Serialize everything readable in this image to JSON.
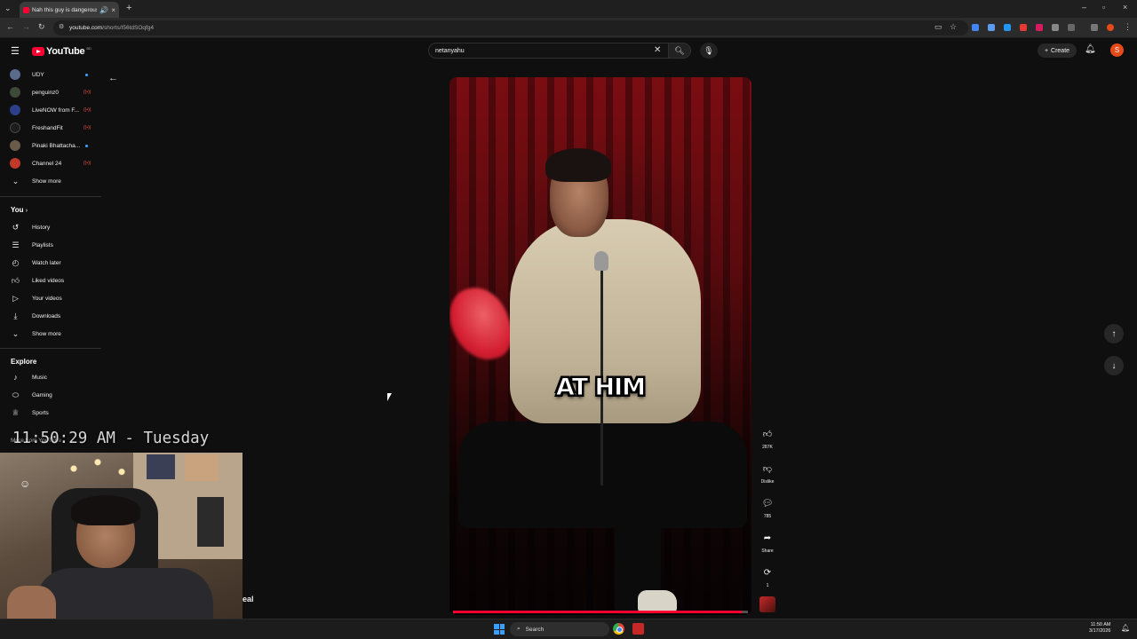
{
  "browser": {
    "tab_title": "Nah this guy is dangerous",
    "url_host": "youtube.com",
    "url_path": "/shorts/I56tdSOqfg4"
  },
  "header": {
    "logo_text": "YouTube",
    "country_code": "BD",
    "search_value": "netanyahu",
    "create_label": "Create",
    "avatar_letter": "S"
  },
  "sidebar": {
    "subscriptions": [
      {
        "label": "UDY",
        "indicator": "dot",
        "color": "#5b6b8c"
      },
      {
        "label": "penguinz0",
        "indicator": "live",
        "color": "#3d4a3a"
      },
      {
        "label": "LiveNOW from F...",
        "indicator": "live",
        "color": "#2d3f8a"
      },
      {
        "label": "FreshandFit",
        "indicator": "live",
        "color": "#1d1d1d"
      },
      {
        "label": "Pinaki Bhattacha...",
        "indicator": "dot",
        "color": "#6a5a4a"
      },
      {
        "label": "Channel 24",
        "indicator": "live",
        "color": "#c0392b"
      }
    ],
    "show_more_1": "Show more",
    "you_heading": "You",
    "you_items": [
      {
        "label": "History",
        "icon": "history-icon",
        "glyph": "↺"
      },
      {
        "label": "Playlists",
        "icon": "playlists-icon",
        "glyph": "☰"
      },
      {
        "label": "Watch later",
        "icon": "clock-icon",
        "glyph": "◴"
      },
      {
        "label": "Liked videos",
        "icon": "thumbs-up-icon",
        "glyph": "👍"
      },
      {
        "label": "Your videos",
        "icon": "video-icon",
        "glyph": "▷"
      },
      {
        "label": "Downloads",
        "icon": "download-icon",
        "glyph": "⤓"
      }
    ],
    "show_more_2": "Show more",
    "explore_heading": "Explore",
    "explore_items": [
      {
        "label": "Music",
        "icon": "music-note-icon",
        "glyph": "♪"
      },
      {
        "label": "Gaming",
        "icon": "gamepad-icon",
        "glyph": "⬭"
      },
      {
        "label": "Sports",
        "icon": "trophy-icon",
        "glyph": "♕"
      }
    ],
    "more_from": "More from YouTube"
  },
  "player": {
    "caption": "AT HIM",
    "progress": 0.98
  },
  "actions": {
    "likes": "287K",
    "dislike_label": "Dislike",
    "comments": "785",
    "share_label": "Share",
    "remix_count": "1"
  },
  "overlay": {
    "clock_text": "11:50:29 AM - Tuesday",
    "partial_text": "eal"
  },
  "taskbar": {
    "search_label": "Search",
    "time": "11:50 AM",
    "date": "3/17/2026"
  },
  "colors": {
    "brand_red": "#ff0033",
    "background": "#0f0f0f"
  }
}
